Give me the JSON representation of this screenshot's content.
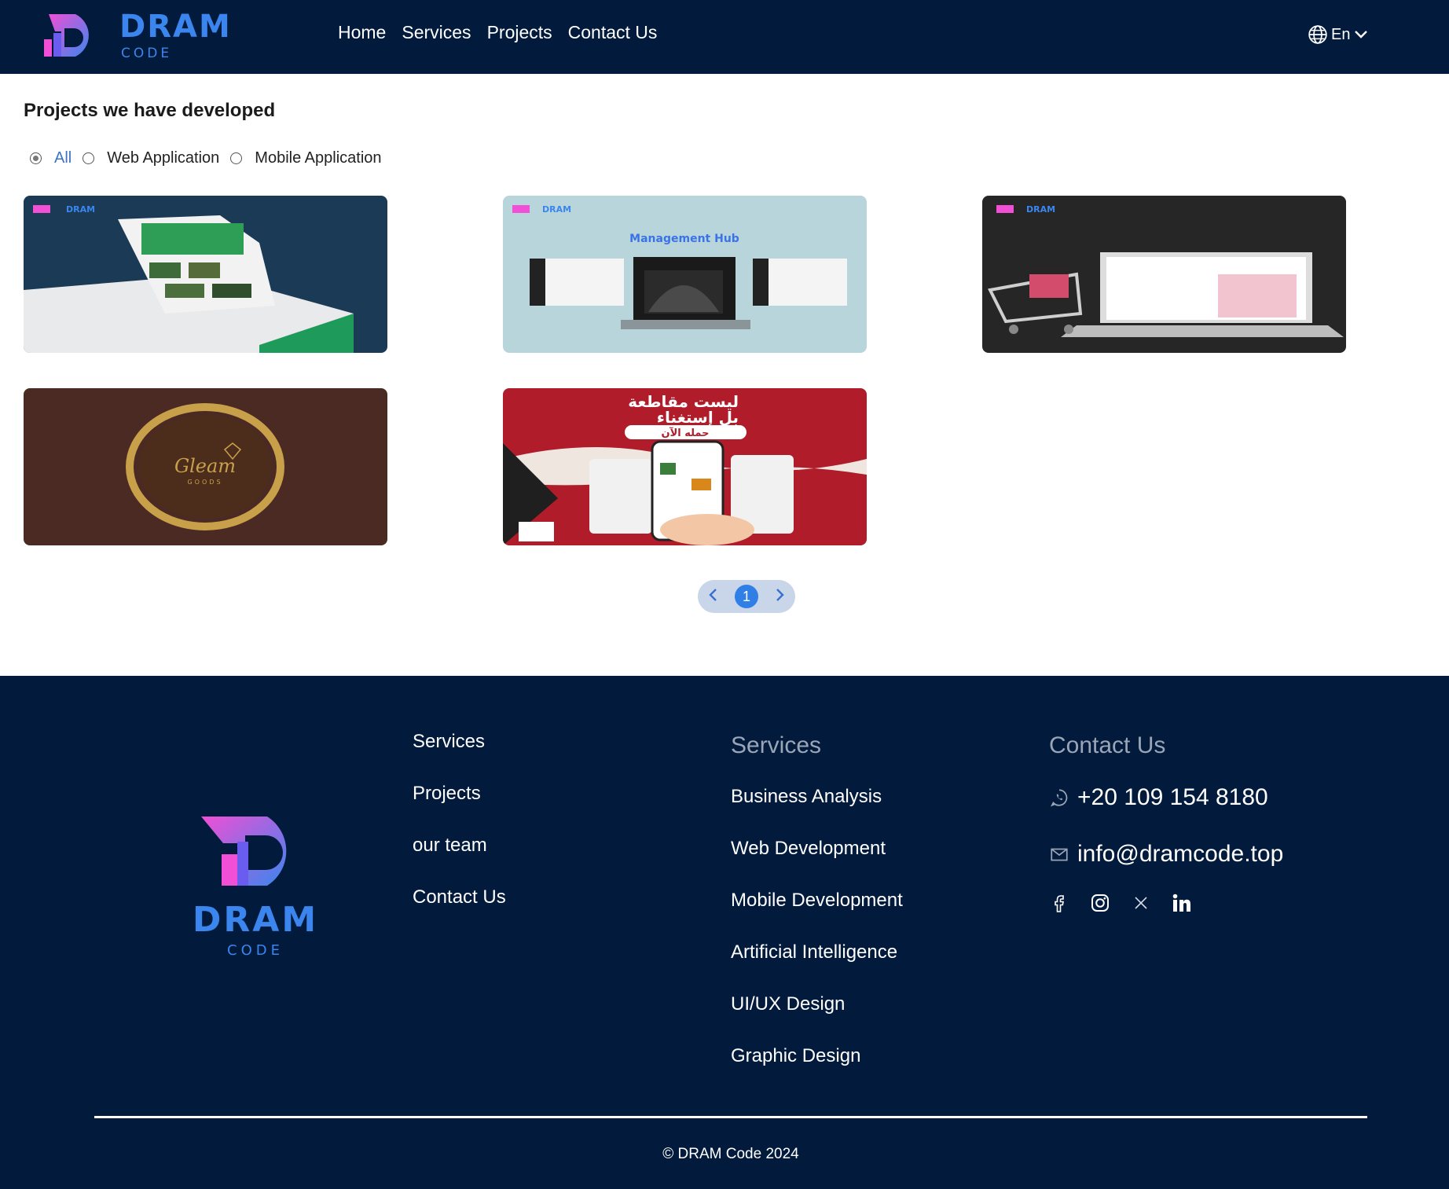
{
  "brand": {
    "name": "DRAM",
    "sub": "CODE",
    "color": "#3a86ee",
    "accent_pink": "#f04fd6"
  },
  "nav": {
    "links": [
      "Home",
      "Services",
      "Projects",
      "Contact Us"
    ],
    "language": "En",
    "language_icon": "globe-icon"
  },
  "main": {
    "title": "Projects we have developed",
    "filters": [
      {
        "label": "All",
        "selected": true
      },
      {
        "label": "Web Application",
        "selected": false
      },
      {
        "label": "Mobile Application",
        "selected": false
      }
    ],
    "cards": [
      {
        "banner_text": "DRAM",
        "description": "laptop showing a football booking web app"
      },
      {
        "banner_text": "Management Hub",
        "description": "laptop with dashboard screens"
      },
      {
        "banner_text": "DRAM",
        "description": "laptop with e-commerce site and shopping cart"
      },
      {
        "banner_text": "Gleam",
        "sub_text": "GOODS",
        "description": "gold ring logo on brown background"
      },
      {
        "banner_text": "ليست مقاطعة",
        "banner_text2": "بل إستغناء",
        "button_text": "حمله الآن",
        "description": "hand holding phone with mobile app on red background"
      }
    ],
    "pagination": {
      "current": "1",
      "prev_icon": "chevron-left-icon",
      "next_icon": "chevron-right-icon"
    }
  },
  "footer": {
    "links": [
      "Services",
      "Projects",
      "our team",
      "Contact Us"
    ],
    "services_heading": "Services",
    "services": [
      "Business Analysis",
      "Web Development",
      "Mobile Development",
      "Artificial Intelligence",
      "UI/UX Design",
      "Graphic Design"
    ],
    "contact_heading": "Contact Us",
    "phone": "+20 109 154 8180",
    "email": "info@dramcode.top",
    "socials": [
      "facebook-icon",
      "instagram-icon",
      "x-icon",
      "linkedin-icon"
    ],
    "copyright": "© DRAM Code 2024"
  },
  "colors": {
    "navy": "#021a3b",
    "active_blue": "#3a73c9",
    "page_blue": "#2f7fe6"
  }
}
